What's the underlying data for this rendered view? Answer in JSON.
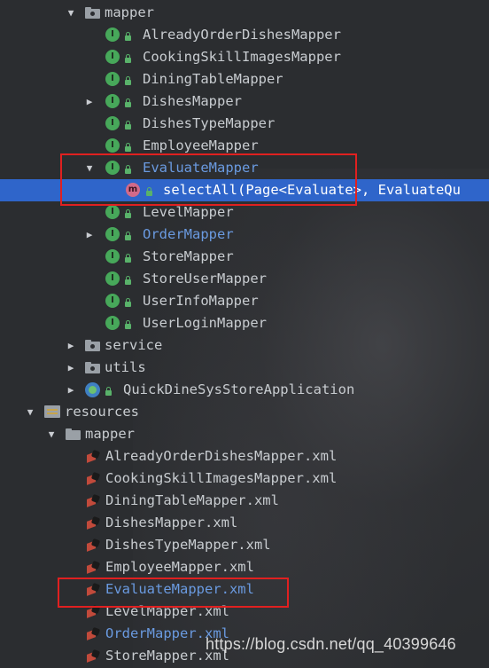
{
  "tree": {
    "rows": [
      {
        "label": "mapper",
        "icon": "folder-icon",
        "arrow": "expanded",
        "color": "normal"
      },
      {
        "label": "AlreadyOrderDishesMapper",
        "icon": "interface-icon",
        "arrow": "none",
        "color": "normal"
      },
      {
        "label": "CookingSkillImagesMapper",
        "icon": "interface-icon",
        "arrow": "none",
        "color": "normal"
      },
      {
        "label": "DiningTableMapper",
        "icon": "interface-icon",
        "arrow": "none",
        "color": "normal"
      },
      {
        "label": "DishesMapper",
        "icon": "interface-icon",
        "arrow": "collapsed",
        "color": "normal"
      },
      {
        "label": "DishesTypeMapper",
        "icon": "interface-icon",
        "arrow": "none",
        "color": "normal"
      },
      {
        "label": "EmployeeMapper",
        "icon": "interface-icon",
        "arrow": "none",
        "color": "normal"
      },
      {
        "label": "EvaluateMapper",
        "icon": "interface-icon",
        "arrow": "expanded",
        "color": "vcs"
      },
      {
        "label": "selectAll(Page<Evaluate>, EvaluateQu",
        "icon": "method-icon",
        "arrow": "none",
        "color": "selected"
      },
      {
        "label": "LevelMapper",
        "icon": "interface-icon",
        "arrow": "none",
        "color": "normal"
      },
      {
        "label": "OrderMapper",
        "icon": "interface-icon",
        "arrow": "collapsed",
        "color": "vcs"
      },
      {
        "label": "StoreMapper",
        "icon": "interface-icon",
        "arrow": "none",
        "color": "normal"
      },
      {
        "label": "StoreUserMapper",
        "icon": "interface-icon",
        "arrow": "none",
        "color": "normal"
      },
      {
        "label": "UserInfoMapper",
        "icon": "interface-icon",
        "arrow": "none",
        "color": "normal"
      },
      {
        "label": "UserLoginMapper",
        "icon": "interface-icon",
        "arrow": "none",
        "color": "normal"
      },
      {
        "label": "service",
        "icon": "folder-icon",
        "arrow": "collapsed",
        "color": "normal"
      },
      {
        "label": "utils",
        "icon": "folder-icon",
        "arrow": "collapsed",
        "color": "normal"
      },
      {
        "label": "QuickDineSysStoreApplication",
        "icon": "spring-app-icon",
        "arrow": "collapsed",
        "color": "normal"
      },
      {
        "label": "resources",
        "icon": "resources-folder-icon",
        "arrow": "expanded",
        "color": "normal"
      },
      {
        "label": "mapper",
        "icon": "folder-icon",
        "arrow": "expanded",
        "color": "normal"
      },
      {
        "label": "AlreadyOrderDishesMapper.xml",
        "icon": "xml-file-icon",
        "arrow": "none",
        "color": "normal"
      },
      {
        "label": "CookingSkillImagesMapper.xml",
        "icon": "xml-file-icon",
        "arrow": "none",
        "color": "normal"
      },
      {
        "label": "DiningTableMapper.xml",
        "icon": "xml-file-icon",
        "arrow": "none",
        "color": "normal"
      },
      {
        "label": "DishesMapper.xml",
        "icon": "xml-file-icon",
        "arrow": "none",
        "color": "normal"
      },
      {
        "label": "DishesTypeMapper.xml",
        "icon": "xml-file-icon",
        "arrow": "none",
        "color": "normal"
      },
      {
        "label": "EmployeeMapper.xml",
        "icon": "xml-file-icon",
        "arrow": "none",
        "color": "normal"
      },
      {
        "label": "EvaluateMapper.xml",
        "icon": "xml-file-icon",
        "arrow": "none",
        "color": "vcs"
      },
      {
        "label": "LevelMapper.xml",
        "icon": "xml-file-icon",
        "arrow": "none",
        "color": "normal"
      },
      {
        "label": "OrderMapper.xml",
        "icon": "xml-file-icon",
        "arrow": "none",
        "color": "vcs"
      },
      {
        "label": "StoreMapper.xml",
        "icon": "xml-file-icon",
        "arrow": "none",
        "color": "normal"
      }
    ]
  },
  "watermark": "https://blog.csdn.net/qq_40399646",
  "colors": {
    "background": "#2b2d30",
    "selection": "#2f65ca",
    "text": "#c8ccd0",
    "vcs_modified": "#6a9ae0",
    "highlight_box": "#e02020"
  }
}
